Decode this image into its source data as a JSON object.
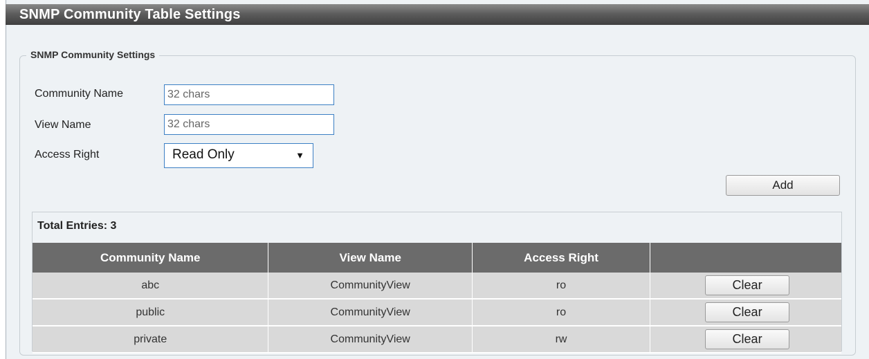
{
  "page": {
    "title": "SNMP Community Table Settings",
    "section_legend": "SNMP Community Settings"
  },
  "form": {
    "community_name": {
      "label": "Community Name",
      "placeholder": "32 chars",
      "value": ""
    },
    "view_name": {
      "label": "View Name",
      "placeholder": "32 chars",
      "value": ""
    },
    "access_right": {
      "label": "Access Right",
      "selected": "Read Only"
    },
    "add_label": "Add"
  },
  "table": {
    "total_entries": "Total Entries: 3",
    "headers": [
      "Community Name",
      "View Name",
      "Access Right",
      ""
    ],
    "rows": [
      {
        "community": "abc",
        "view": "CommunityView",
        "access": "ro",
        "action": "Clear"
      },
      {
        "community": "public",
        "view": "CommunityView",
        "access": "ro",
        "action": "Clear"
      },
      {
        "community": "private",
        "view": "CommunityView",
        "access": "rw",
        "action": "Clear"
      }
    ]
  }
}
